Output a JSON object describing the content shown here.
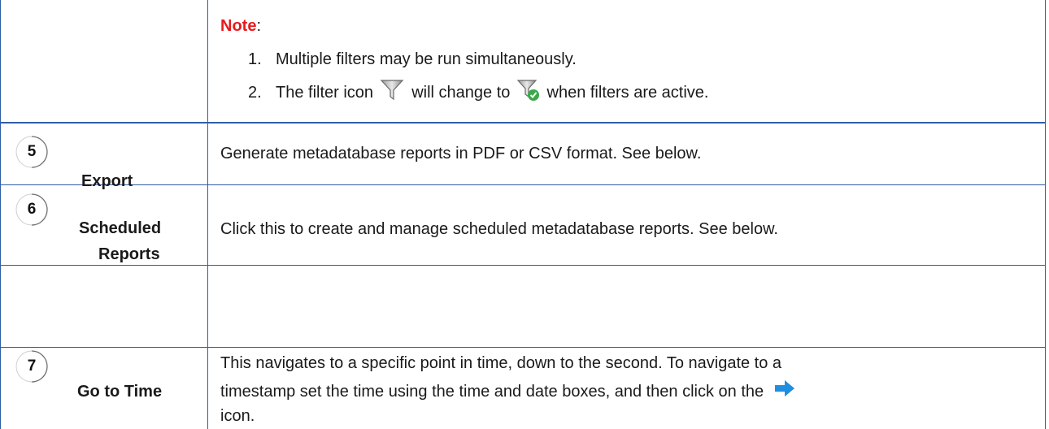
{
  "note": {
    "label": "Note",
    "colon": ":",
    "items": [
      {
        "num": "1.",
        "text": "Multiple filters may be run simultaneously."
      },
      {
        "num": "2.",
        "text_before": "The filter icon",
        "text_middle": "will change to",
        "text_after": "when filters are active."
      }
    ]
  },
  "rows": [
    {
      "badge": "5",
      "label_lines": [
        "Export"
      ],
      "description": "Generate metadatabase reports in PDF or CSV format. See below."
    },
    {
      "badge": "6",
      "label_lines": [
        "Scheduled",
        "Reports"
      ],
      "description": "Click this to create and manage scheduled metadatabase reports. See below."
    },
    {
      "badge": "7",
      "label_lines": [
        "Go to Time"
      ],
      "description_lines": [
        "This navigates to a specific point in time, down to the second. To navigate to a",
        "timestamp set the time using the time and date boxes, and then click on the"
      ],
      "description_tail": "icon."
    }
  ],
  "icons": [
    "filter-icon",
    "filter-active-icon",
    "arrow-right-icon"
  ],
  "colors": {
    "border": "#2f5ea6",
    "note": "#e8191d",
    "arrow": "#1e8fe0"
  }
}
